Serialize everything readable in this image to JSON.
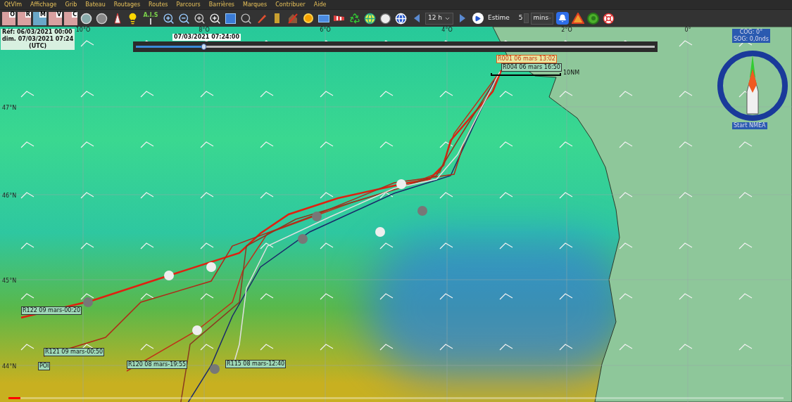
{
  "menu": [
    "QtVlm",
    "Affichage",
    "Grib",
    "Bateau",
    "Routages",
    "Routes",
    "Parcours",
    "Barrières",
    "Marques",
    "Contribuer",
    "Aide"
  ],
  "toolbar": {
    "tiles": [
      "O",
      "R",
      "M",
      "V",
      "C"
    ],
    "ais_label": "A.I.S",
    "step": "12 h",
    "estime": "Estime",
    "count": "5",
    "unit": "mins"
  },
  "info": {
    "ref": "Réf: 06/03/2021 00:00",
    "dim": "dim. 07/03/2021 07:24",
    "tz": "(UTC)"
  },
  "time_slider": {
    "label": "07/03/2021 07:24:00",
    "level": 0.13
  },
  "longitudes": [
    "10°O",
    "8°O",
    "6°O",
    "4°O",
    "2°O",
    "0°"
  ],
  "latitudes": [
    "47°N",
    "46°N",
    "45°N",
    "44°N"
  ],
  "route_labels": [
    {
      "text": "R001 06 mars 13:02",
      "kind": "highlight"
    },
    {
      "text": "R004 06 mars 16:50",
      "kind": "plain"
    },
    {
      "text": "R122 09 mars-00:20",
      "kind": "plain"
    },
    {
      "text": "R121 09 mars-00:50",
      "kind": "plain"
    },
    {
      "text": "POI",
      "kind": "plain"
    },
    {
      "text": "R120 08 mars-19:55",
      "kind": "plain"
    },
    {
      "text": "R115 08 mars-12:40",
      "kind": "plain"
    }
  ],
  "scale": {
    "label": "10NM"
  },
  "boat": {
    "cog": "COG: 0°",
    "sog": "SOG: 0,0nds",
    "button": "Start NMEA"
  },
  "video": {
    "level": 0.015
  }
}
